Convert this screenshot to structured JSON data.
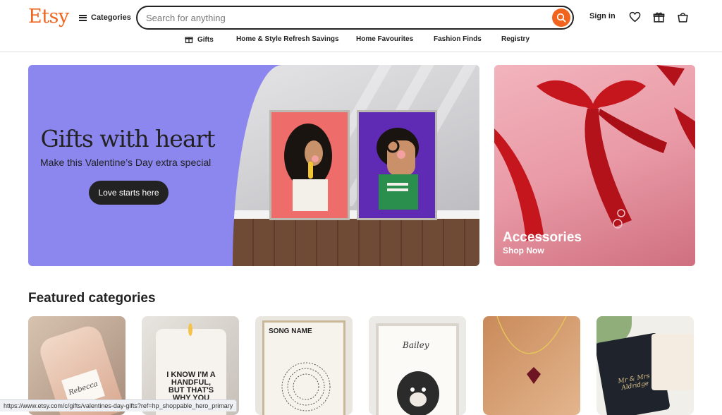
{
  "header": {
    "logo": "Etsy",
    "categories_label": "Categories",
    "search_placeholder": "Search for anything",
    "sign_in": "Sign in"
  },
  "subnav": {
    "items": [
      "Gifts",
      "Home & Style Refresh Savings",
      "Home Favourites",
      "Fashion Finds",
      "Registry"
    ]
  },
  "hero": {
    "title": "Gifts with heart",
    "subtitle": "Make this Valentine’s Day extra special",
    "button": "Love starts here"
  },
  "accessories": {
    "title": "Accessories",
    "cta": "Shop Now"
  },
  "featured": {
    "title": "Featured categories",
    "tiles": [
      {
        "label_text": "Rebecca"
      },
      {
        "label_text": "I KNOW I'M A HANDFUL, BUT THAT'S WHY YOU HAVE"
      },
      {
        "label_text": "SONG NAME"
      },
      {
        "label_text": "Bailey"
      },
      {
        "label_text": ""
      },
      {
        "label_text": "Mr & Mrs Aldridge"
      }
    ]
  },
  "status_bar": {
    "url": "https://www.etsy.com/c/gifts/valentines-day-gifts?ref=hp_shoppable_hero_primary"
  },
  "colors": {
    "brand": "#f1641e",
    "hero_bg": "#8c87ee",
    "dark": "#222222"
  }
}
